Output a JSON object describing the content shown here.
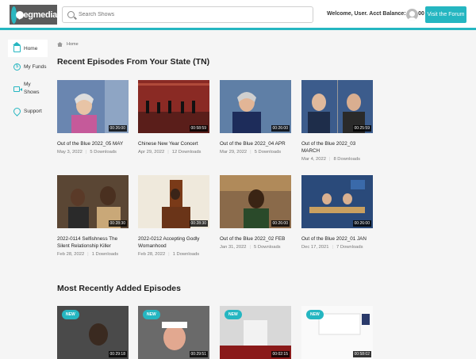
{
  "header": {
    "logo_text": "pegmedia",
    "search_placeholder": "Search Shows",
    "welcome": "Welcome, User. Acct Balance: $15.00",
    "forum_button": "Visit the Forum"
  },
  "sidebar": {
    "items": [
      {
        "label": "Home",
        "icon": "home-icon"
      },
      {
        "label": "My Funds",
        "icon": "funds-icon"
      },
      {
        "label": "My Shows",
        "icon": "video-icon"
      },
      {
        "label": "Support",
        "icon": "support-icon"
      }
    ]
  },
  "breadcrumb": "Home",
  "section1": {
    "title": "Recent Episodes From Your State (TN)",
    "episodes": [
      {
        "title": "Out of the Blue 2022_05 MAY",
        "date": "May 3, 2022",
        "downloads": "5 Downloads",
        "duration": "00:26:00"
      },
      {
        "title": "Chinese New Year Concert",
        "date": "Apr 29, 2022",
        "downloads": "12 Downloads",
        "duration": "00:58:59"
      },
      {
        "title": "Out of the Blue 2022_04 APR",
        "date": "Mar 29, 2022",
        "downloads": "5 Downloads",
        "duration": "00:26:00"
      },
      {
        "title": "Out of the Blue 2022_03 MARCH",
        "date": "Mar 4, 2022",
        "downloads": "8 Downloads",
        "duration": "00:25:59"
      },
      {
        "title": "2022-0114 Selfishness The Silent Relationship Killer",
        "date": "Feb 28, 2022",
        "downloads": "1 Downloads",
        "duration": "00:28:30"
      },
      {
        "title": "2022-0212 Accepting Godly Womanhood",
        "date": "Feb 28, 2022",
        "downloads": "1 Downloads",
        "duration": "00:28:30"
      },
      {
        "title": "Out of the Blue 2022_02 FEB",
        "date": "Jan 31, 2022",
        "downloads": "5 Downloads",
        "duration": "00:26:00"
      },
      {
        "title": "Out of the Blue 2022_01 JAN",
        "date": "Dec 17, 2021",
        "downloads": "7 Downloads",
        "duration": "00:26:00"
      }
    ]
  },
  "section2": {
    "title": "Most Recently Added Episodes",
    "episodes": [
      {
        "badge": "NEW",
        "duration": "00:29:18"
      },
      {
        "badge": "NEW",
        "duration": "00:29:51"
      },
      {
        "badge": "NEW",
        "duration": "00:02:15"
      },
      {
        "badge": "NEW",
        "duration": "00:58:02"
      }
    ]
  },
  "colors": {
    "accent": "#25b6c1"
  }
}
